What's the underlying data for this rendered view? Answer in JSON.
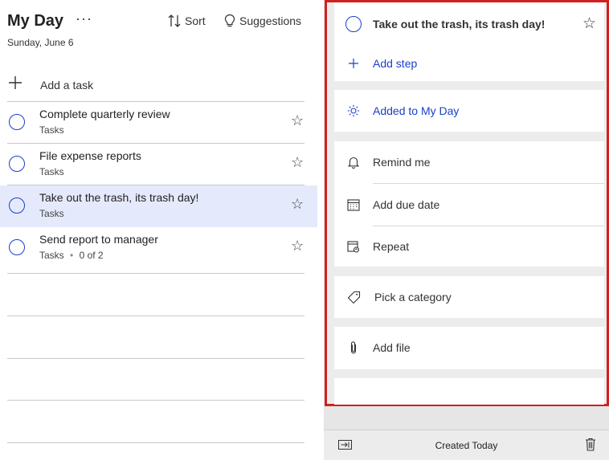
{
  "header": {
    "title": "My Day",
    "more_label": "···",
    "date": "Sunday, June 6",
    "sort_label": "Sort",
    "suggestions_label": "Suggestions"
  },
  "add_task": {
    "icon": "plus-icon",
    "label": "Add a task"
  },
  "tasks": [
    {
      "name": "Complete quarterly review",
      "list": "Tasks",
      "steps": "",
      "selected": false
    },
    {
      "name": "File expense reports",
      "list": "Tasks",
      "steps": "",
      "selected": false
    },
    {
      "name": "Take out the trash, its trash day!",
      "list": "Tasks",
      "steps": "",
      "selected": true
    },
    {
      "name": "Send report to manager",
      "list": "Tasks",
      "steps": "0 of 2",
      "selected": false
    }
  ],
  "detail": {
    "title": "Take out the trash, its trash day!",
    "add_step_label": "Add step",
    "added_to_my_day_label": "Added to My Day",
    "remind_me_label": "Remind me",
    "add_due_date_label": "Add due date",
    "repeat_label": "Repeat",
    "pick_category_label": "Pick a category",
    "add_file_label": "Add file",
    "footer_text": "Created Today"
  },
  "colors": {
    "accent_blue": "#1a3fc8",
    "selected_row": "#e5e9fc",
    "highlight_frame": "#d12020"
  }
}
